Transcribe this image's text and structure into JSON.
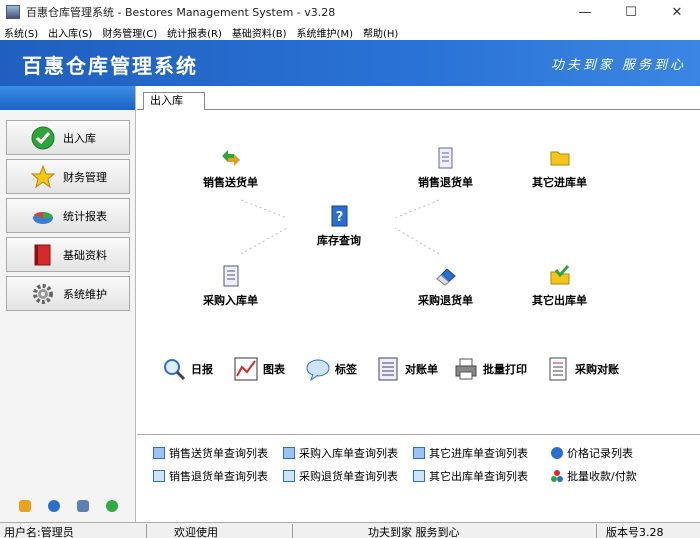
{
  "window": {
    "title": "百惠仓库管理系统 - Bestores Management System - v3.28",
    "min": "—",
    "max": "☐",
    "close": "✕"
  },
  "menu": [
    "系统(S)",
    "出入库(S)",
    "财务管理(C)",
    "统计报表(R)",
    "基础资料(B)",
    "系统维护(M)",
    "帮助(H)"
  ],
  "banner": {
    "app_name": "百惠仓库管理系统",
    "slogan": "功夫到家 服务到心"
  },
  "sidebar": {
    "items": [
      {
        "label": "出入库",
        "icon": "check-icon"
      },
      {
        "label": "财务管理",
        "icon": "star-icon"
      },
      {
        "label": "统计报表",
        "icon": "pie-chart-icon"
      },
      {
        "label": "基础资料",
        "icon": "book-icon"
      },
      {
        "label": "系统维护",
        "icon": "gear-icon"
      }
    ]
  },
  "tab": {
    "label": "出入库"
  },
  "flow": {
    "sales_delivery": "销售送货单",
    "sales_return": "销售退货单",
    "other_in": "其它进库单",
    "inventory_query": "库存查询",
    "purchase_in": "采购入库单",
    "purchase_return": "采购退货单",
    "other_out": "其它出库单"
  },
  "tools": {
    "daily": "日报",
    "chart": "图表",
    "label": "标签",
    "statement": "对账单",
    "batch_print": "批量打印",
    "purchase_reconcile": "采购对账"
  },
  "links": {
    "sales_delivery_list": "销售送货单查询列表",
    "purchase_in_list": "采购入库单查询列表",
    "other_in_list": "其它进库单查询列表",
    "price_record_list": "价格记录列表",
    "sales_return_list": "销售退货单查询列表",
    "purchase_return_list": "采购退货单查询列表",
    "other_out_list": "其它出库单查询列表",
    "batch_payment": "批量收款/付款"
  },
  "status": {
    "user": "用户名:管理员",
    "welcome": "欢迎使用",
    "slogan": "功夫到家 服务到心",
    "version": "版本号3.28"
  },
  "colors": {
    "banner": "#2a73d6",
    "sidebar_head": "#1a62c7",
    "sidebar_bg": "#f4f4f4"
  }
}
